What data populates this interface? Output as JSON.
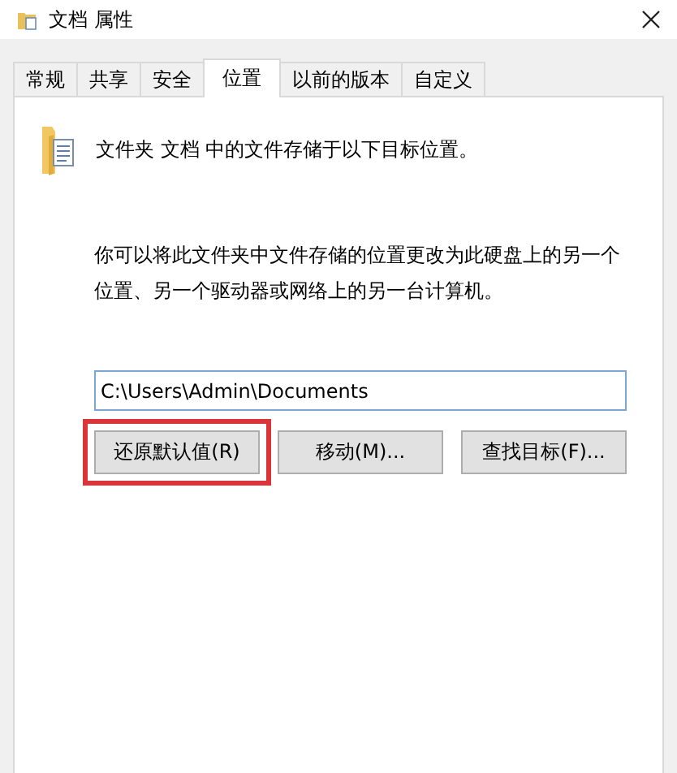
{
  "window": {
    "title": "文档 属性"
  },
  "tabs": [
    {
      "label": "常规",
      "selected": false
    },
    {
      "label": "共享",
      "selected": false
    },
    {
      "label": "安全",
      "selected": false
    },
    {
      "label": "位置",
      "selected": true
    },
    {
      "label": "以前的版本",
      "selected": false
    },
    {
      "label": "自定义",
      "selected": false
    }
  ],
  "header_text": "文件夹 文档 中的文件存储于以下目标位置。",
  "description": "你可以将此文件夹中文件存储的位置更改为此硬盘上的另一个位置、另一个驱动器或网络上的另一台计算机。",
  "path_field": {
    "value": "C:\\Users\\Admin\\Documents"
  },
  "buttons": [
    {
      "label": "还原默认值(R)",
      "highlighted": true
    },
    {
      "label": "移动(M)...",
      "highlighted": false
    },
    {
      "label": "查找目标(F)...",
      "highlighted": false
    }
  ]
}
